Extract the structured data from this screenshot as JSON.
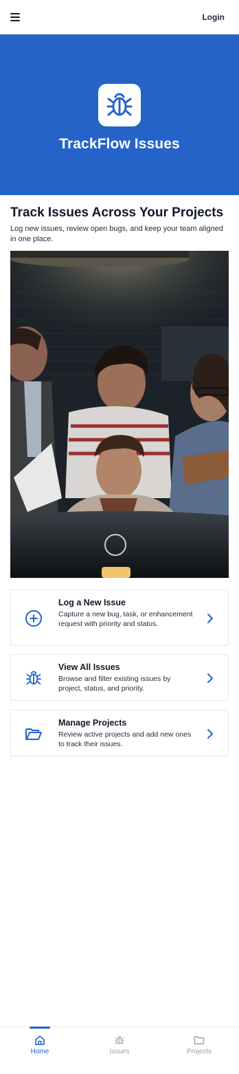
{
  "header": {
    "login_label": "Login"
  },
  "hero": {
    "title": "TrackFlow Issues"
  },
  "intro": {
    "heading": "Track Issues Across Your Projects",
    "subtext": "Log new issues, review open bugs, and keep your team aligned in one place."
  },
  "cards": [
    {
      "title": "Log a New Issue",
      "description": "Capture a new bug, task, or enhancement request with priority and status.",
      "icon": "plus-circle-icon"
    },
    {
      "title": "View All Issues",
      "description": "Browse and filter existing issues by project, status, and priority.",
      "icon": "bug-icon"
    },
    {
      "title": "Manage Projects",
      "description": "Review active projects and add new ones to track their issues.",
      "icon": "folder-icon"
    }
  ],
  "nav": [
    {
      "label": "Home",
      "icon": "home-icon",
      "active": true
    },
    {
      "label": "Issues",
      "icon": "bug-icon",
      "active": false
    },
    {
      "label": "Projects",
      "icon": "folder-icon",
      "active": false
    }
  ],
  "colors": {
    "brand": "#2563c9",
    "muted": "#9aa1ab"
  }
}
